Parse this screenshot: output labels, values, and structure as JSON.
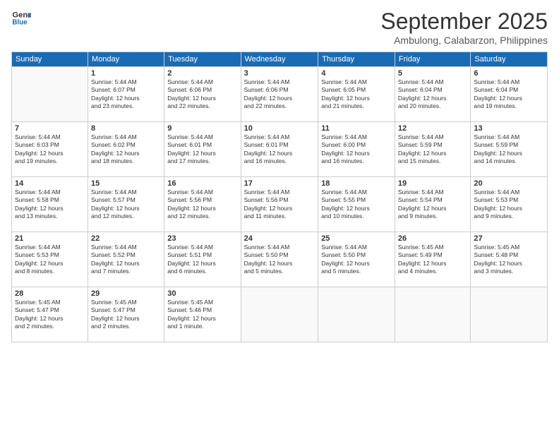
{
  "logo": {
    "line1": "General",
    "line2": "Blue"
  },
  "header": {
    "month": "September 2025",
    "location": "Ambulong, Calabarzon, Philippines"
  },
  "days_of_week": [
    "Sunday",
    "Monday",
    "Tuesday",
    "Wednesday",
    "Thursday",
    "Friday",
    "Saturday"
  ],
  "weeks": [
    [
      {
        "day": "",
        "info": ""
      },
      {
        "day": "1",
        "info": "Sunrise: 5:44 AM\nSunset: 6:07 PM\nDaylight: 12 hours\nand 23 minutes."
      },
      {
        "day": "2",
        "info": "Sunrise: 5:44 AM\nSunset: 6:06 PM\nDaylight: 12 hours\nand 22 minutes."
      },
      {
        "day": "3",
        "info": "Sunrise: 5:44 AM\nSunset: 6:06 PM\nDaylight: 12 hours\nand 22 minutes."
      },
      {
        "day": "4",
        "info": "Sunrise: 5:44 AM\nSunset: 6:05 PM\nDaylight: 12 hours\nand 21 minutes."
      },
      {
        "day": "5",
        "info": "Sunrise: 5:44 AM\nSunset: 6:04 PM\nDaylight: 12 hours\nand 20 minutes."
      },
      {
        "day": "6",
        "info": "Sunrise: 5:44 AM\nSunset: 6:04 PM\nDaylight: 12 hours\nand 19 minutes."
      }
    ],
    [
      {
        "day": "7",
        "info": "Sunrise: 5:44 AM\nSunset: 6:03 PM\nDaylight: 12 hours\nand 19 minutes."
      },
      {
        "day": "8",
        "info": "Sunrise: 5:44 AM\nSunset: 6:02 PM\nDaylight: 12 hours\nand 18 minutes."
      },
      {
        "day": "9",
        "info": "Sunrise: 5:44 AM\nSunset: 6:01 PM\nDaylight: 12 hours\nand 17 minutes."
      },
      {
        "day": "10",
        "info": "Sunrise: 5:44 AM\nSunset: 6:01 PM\nDaylight: 12 hours\nand 16 minutes."
      },
      {
        "day": "11",
        "info": "Sunrise: 5:44 AM\nSunset: 6:00 PM\nDaylight: 12 hours\nand 16 minutes."
      },
      {
        "day": "12",
        "info": "Sunrise: 5:44 AM\nSunset: 5:59 PM\nDaylight: 12 hours\nand 15 minutes."
      },
      {
        "day": "13",
        "info": "Sunrise: 5:44 AM\nSunset: 5:59 PM\nDaylight: 12 hours\nand 14 minutes."
      }
    ],
    [
      {
        "day": "14",
        "info": "Sunrise: 5:44 AM\nSunset: 5:58 PM\nDaylight: 12 hours\nand 13 minutes."
      },
      {
        "day": "15",
        "info": "Sunrise: 5:44 AM\nSunset: 5:57 PM\nDaylight: 12 hours\nand 12 minutes."
      },
      {
        "day": "16",
        "info": "Sunrise: 5:44 AM\nSunset: 5:56 PM\nDaylight: 12 hours\nand 12 minutes."
      },
      {
        "day": "17",
        "info": "Sunrise: 5:44 AM\nSunset: 5:56 PM\nDaylight: 12 hours\nand 11 minutes."
      },
      {
        "day": "18",
        "info": "Sunrise: 5:44 AM\nSunset: 5:55 PM\nDaylight: 12 hours\nand 10 minutes."
      },
      {
        "day": "19",
        "info": "Sunrise: 5:44 AM\nSunset: 5:54 PM\nDaylight: 12 hours\nand 9 minutes."
      },
      {
        "day": "20",
        "info": "Sunrise: 5:44 AM\nSunset: 5:53 PM\nDaylight: 12 hours\nand 9 minutes."
      }
    ],
    [
      {
        "day": "21",
        "info": "Sunrise: 5:44 AM\nSunset: 5:53 PM\nDaylight: 12 hours\nand 8 minutes."
      },
      {
        "day": "22",
        "info": "Sunrise: 5:44 AM\nSunset: 5:52 PM\nDaylight: 12 hours\nand 7 minutes."
      },
      {
        "day": "23",
        "info": "Sunrise: 5:44 AM\nSunset: 5:51 PM\nDaylight: 12 hours\nand 6 minutes."
      },
      {
        "day": "24",
        "info": "Sunrise: 5:44 AM\nSunset: 5:50 PM\nDaylight: 12 hours\nand 5 minutes."
      },
      {
        "day": "25",
        "info": "Sunrise: 5:44 AM\nSunset: 5:50 PM\nDaylight: 12 hours\nand 5 minutes."
      },
      {
        "day": "26",
        "info": "Sunrise: 5:45 AM\nSunset: 5:49 PM\nDaylight: 12 hours\nand 4 minutes."
      },
      {
        "day": "27",
        "info": "Sunrise: 5:45 AM\nSunset: 5:48 PM\nDaylight: 12 hours\nand 3 minutes."
      }
    ],
    [
      {
        "day": "28",
        "info": "Sunrise: 5:45 AM\nSunset: 5:47 PM\nDaylight: 12 hours\nand 2 minutes."
      },
      {
        "day": "29",
        "info": "Sunrise: 5:45 AM\nSunset: 5:47 PM\nDaylight: 12 hours\nand 2 minutes."
      },
      {
        "day": "30",
        "info": "Sunrise: 5:45 AM\nSunset: 5:46 PM\nDaylight: 12 hours\nand 1 minute."
      },
      {
        "day": "",
        "info": ""
      },
      {
        "day": "",
        "info": ""
      },
      {
        "day": "",
        "info": ""
      },
      {
        "day": "",
        "info": ""
      }
    ]
  ]
}
